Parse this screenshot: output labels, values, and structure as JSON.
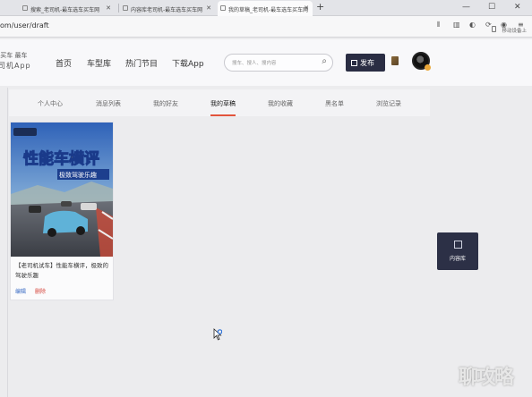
{
  "browser": {
    "tabs": [
      {
        "label": "搜索_老司机-最车选车买车网",
        "active": false
      },
      {
        "label": "内容库老司机-最车选车买车网",
        "active": false
      },
      {
        "label": "我的草稿_老司机-最车选车买车网",
        "active": true
      }
    ],
    "new_tab": "+",
    "url": "om/user/draft",
    "mobile_bookmarks": "移动设备上"
  },
  "site": {
    "logo_line1": "·买车 最车",
    "logo_line2": "司机App",
    "nav": [
      "首页",
      "车型库",
      "热门节目",
      "下载App"
    ],
    "search_placeholder": "搜车、搜人、搜内容",
    "publish_label": "发布"
  },
  "subtabs": [
    {
      "label": "个人中心",
      "active": false
    },
    {
      "label": "消息列表",
      "active": false
    },
    {
      "label": "我的好友",
      "active": false
    },
    {
      "label": "我的草稿",
      "active": true
    },
    {
      "label": "我的收藏",
      "active": false
    },
    {
      "label": "黑名单",
      "active": false
    },
    {
      "label": "浏览记录",
      "active": false
    }
  ],
  "draft": {
    "thumb_title": "性能车横评",
    "thumb_subtitle": "极致驾驶乐趣",
    "title": "【老司机试车】性能车横评，极致的驾驶乐趣",
    "edit_label": "编辑",
    "delete_label": "删除"
  },
  "side_widget": {
    "label": "内容库"
  },
  "watermark": "聊攻略",
  "colors": {
    "accent": "#e2543c",
    "dark": "#2a2d43",
    "link": "#3a6bc4"
  }
}
